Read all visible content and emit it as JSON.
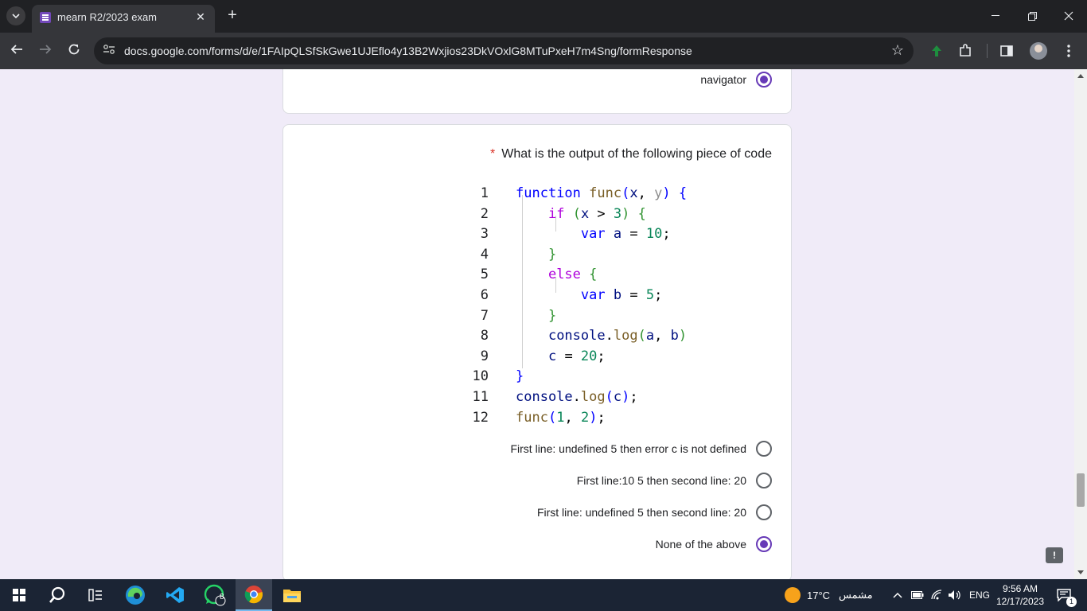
{
  "browser": {
    "tab_title": "mearn R2/2023 exam",
    "tab_close": "✕",
    "new_tab": "+",
    "url": "docs.google.com/forms/d/e/1FAIpQLSfSkGwe1UJEflo4y13B2Wxjios23DkVOxlG8MTuPxeH7m4Sng/formResponse",
    "window_controls": {
      "minimize": "—",
      "restore": "❐",
      "close": "✕"
    }
  },
  "previous_question": {
    "selected_option": "navigator"
  },
  "question": {
    "required_marker": "*",
    "title": "What is the output of the following piece of code",
    "code_line_numbers": [
      "1",
      "2",
      "3",
      "4",
      "5",
      "6",
      "7",
      "8",
      "9",
      "10",
      "11",
      "12"
    ],
    "options": [
      {
        "label": "First line: undefined 5 then error c is not defined",
        "checked": false
      },
      {
        "label": "First line:10  5 then second line: 20",
        "checked": false
      },
      {
        "label": "First line: undefined 5 then second line: 20",
        "checked": false
      },
      {
        "label": "None of the above",
        "checked": true
      }
    ]
  },
  "report_icon": "!",
  "taskbar": {
    "weather_temp": "17°C",
    "weather_desc": "مشمس",
    "language": "ENG",
    "time": "9:56 AM",
    "date": "12/17/2023",
    "whatsapp_badge": "8",
    "notification_badge": "1"
  },
  "colors": {
    "accent": "#673ab7",
    "page_bg": "#f0ebf8",
    "required": "#d93025"
  }
}
